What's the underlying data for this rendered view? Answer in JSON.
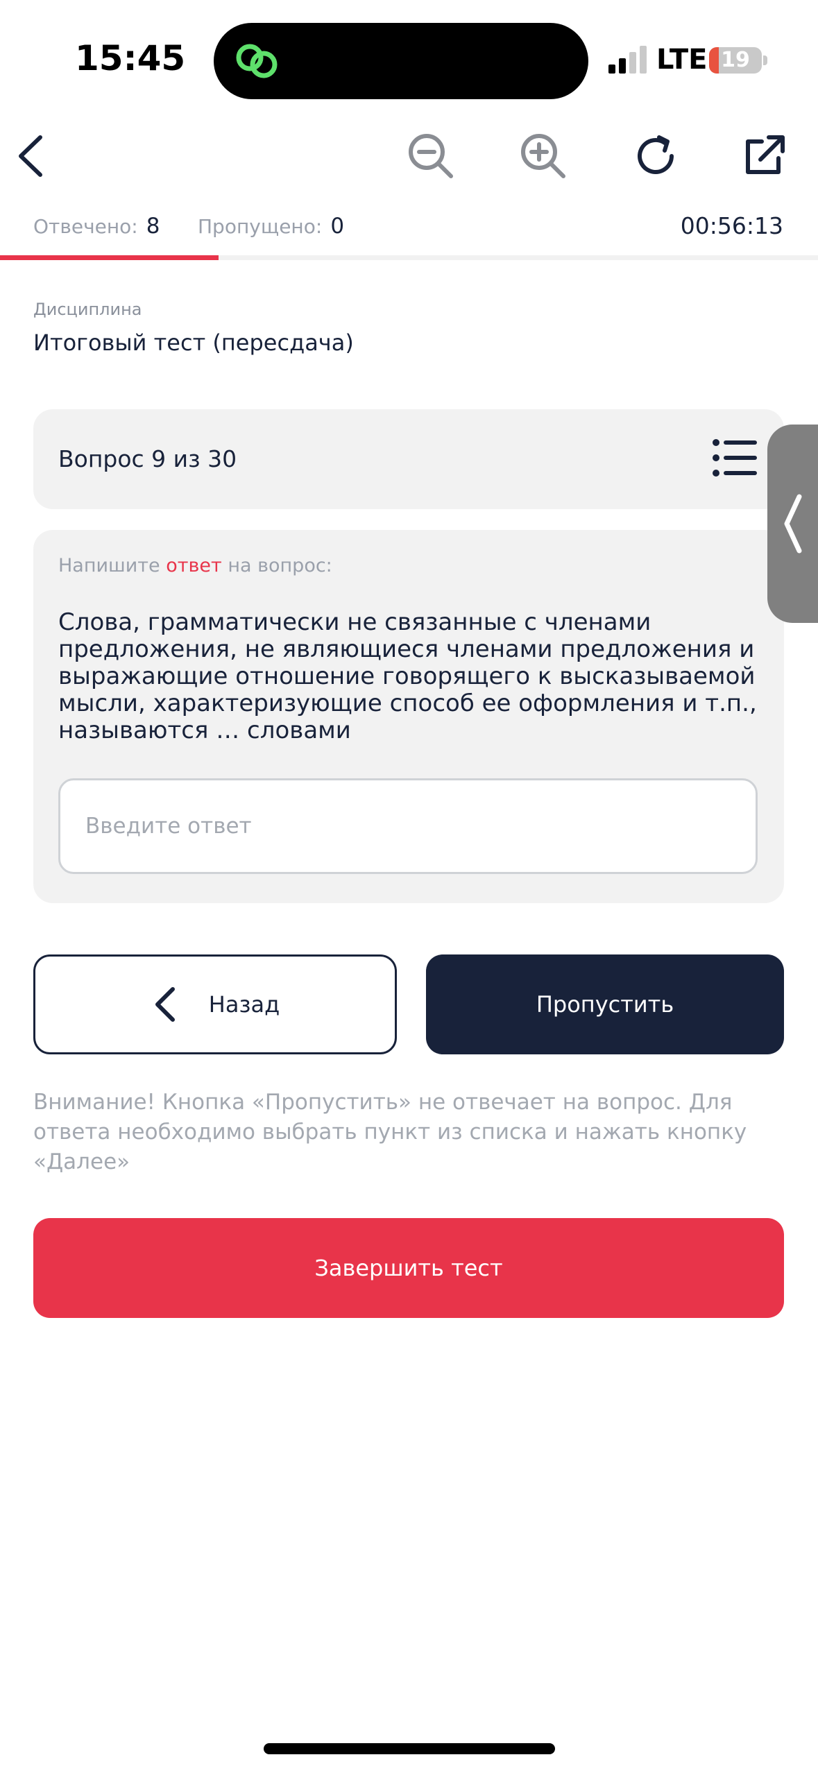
{
  "status_bar": {
    "time": "15:45",
    "network": "LTE",
    "battery_level": "19",
    "battery_fraction": 0.19,
    "island_icon": "link-rings-icon",
    "island_icon_color": "#5ee06b"
  },
  "toolbar": {
    "icons": [
      "chevron-left-icon",
      "zoom-out-icon",
      "zoom-in-icon",
      "reload-icon",
      "external-link-icon"
    ]
  },
  "stats": {
    "answered_label": "Отвечено:",
    "answered_value": "8",
    "skipped_label": "Пропущено:",
    "skipped_value": "0",
    "timer": "00:56:13",
    "progress_fraction": 0.267
  },
  "discipline": {
    "label": "Дисциплина",
    "value": "Итоговый тест (пересдача)"
  },
  "question": {
    "header": "Вопрос 9 из 30",
    "instruction_before": "Напишите ",
    "instruction_accent": "ответ",
    "instruction_after": " на вопрос:",
    "text": "Слова, грамматически не связанные с членами предложения, не являющиеся членами предложения и выражающие отношение говорящего к высказываемой мысли, характеризующие способ ее оформления и т.п., называются … словами",
    "answer_placeholder": "Введите ответ",
    "answer_value": ""
  },
  "buttons": {
    "back": "Назад",
    "skip": "Пропустить",
    "finish": "Завершить тест"
  },
  "warning": "Внимание! Кнопка «Пропустить» не отвечает на вопрос. Для ответа необходимо выбрать пункт из списка и нажать кнопку «Далее»",
  "colors": {
    "accent_red": "#e8344a",
    "primary_navy": "#18223a",
    "card_bg": "#f2f2f2"
  }
}
